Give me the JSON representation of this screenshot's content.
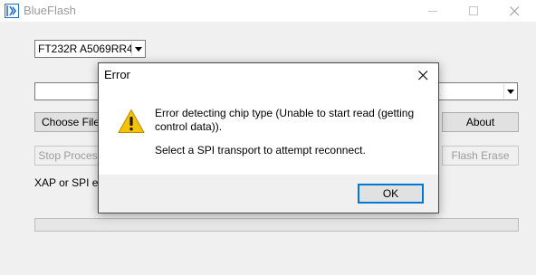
{
  "window": {
    "title": "BlueFlash",
    "icon": "blueflash-app-icon"
  },
  "device_select": {
    "value": "FT232R A5069RR4"
  },
  "transport_select": {
    "value": ""
  },
  "buttons": {
    "choose_file": "Choose File",
    "about": "About",
    "stop_process": "Stop Process",
    "flash_erase": "Flash Erase"
  },
  "status": {
    "text": "XAP or SPI error"
  },
  "progress": {
    "fraction": 0
  },
  "dialog": {
    "title": "Error",
    "icon": "warning-icon",
    "message_line1": "Error detecting chip type (Unable to start read (getting control data)).",
    "message_line2": "Select a SPI transport to attempt reconnect.",
    "ok_label": "OK"
  }
}
